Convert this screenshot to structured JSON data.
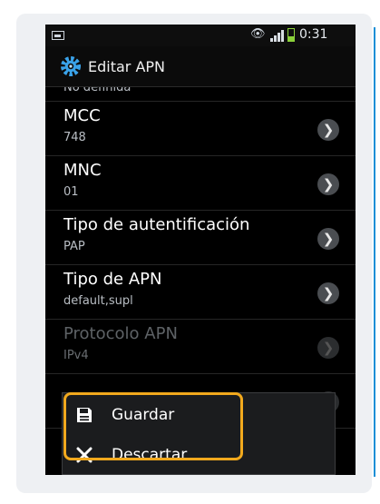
{
  "status_bar": {
    "time": "0:31",
    "icons": [
      "image-icon",
      "eye-icon",
      "signal-icon",
      "battery-icon"
    ]
  },
  "app_bar": {
    "title": "Editar APN",
    "icon": "gear-icon"
  },
  "settings": [
    {
      "label": "",
      "value": "No definida",
      "enabled": true
    },
    {
      "label": "MCC",
      "value": "748",
      "enabled": true
    },
    {
      "label": "MNC",
      "value": "01",
      "enabled": true
    },
    {
      "label": "Tipo de autentificación",
      "value": "PAP",
      "enabled": true
    },
    {
      "label": "Tipo de APN",
      "value": "default,supl",
      "enabled": true
    },
    {
      "label": "Protocolo APN",
      "value": "IPv4",
      "enabled": false
    }
  ],
  "menu": {
    "items": [
      {
        "label": "Guardar",
        "icon": "save-icon"
      },
      {
        "label": "Descartar",
        "icon": "close-icon"
      }
    ]
  },
  "colors": {
    "accent_highlight": "#f2a91d",
    "screen_bg": "#000000",
    "card_bg": "#eef0f3",
    "edge_accent": "#1a8fd6"
  }
}
